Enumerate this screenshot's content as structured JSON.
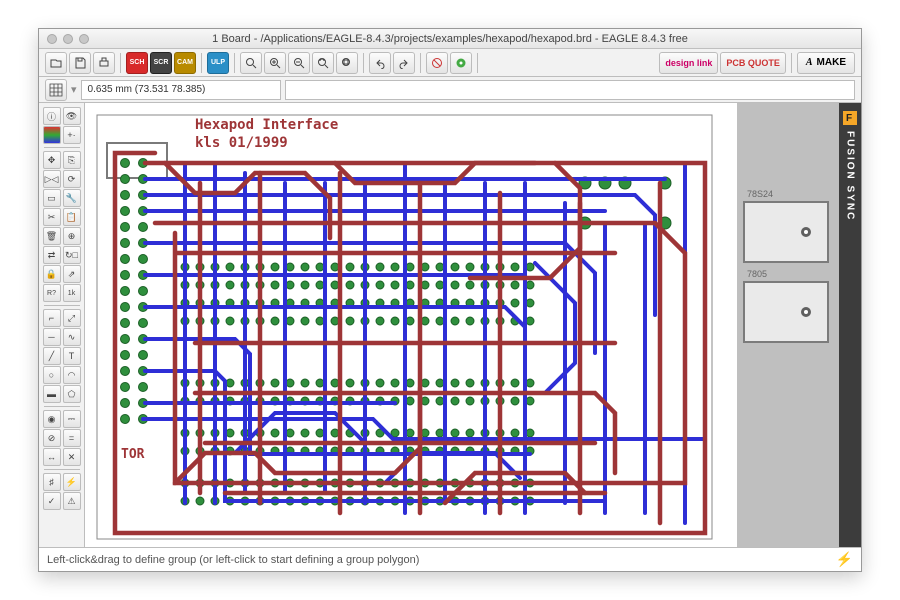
{
  "window": {
    "title": "1 Board - /Applications/EAGLE-8.4.3/projects/examples/hexapod/hexapod.brd - EAGLE 8.4.3 free"
  },
  "toolbar": {
    "sch": "SCH",
    "scr": "SCR",
    "cam": "CAM",
    "ulp": "ULP",
    "design_link": "design link",
    "pcb_quote": "PCB QUOTE",
    "make": "MAKE",
    "autodesk_glyph": "A"
  },
  "coord_readout": "0.635 mm (73.531 78.385)",
  "silkscreen": {
    "line1": "Hexapod Interface",
    "line2": "kls 01/1999",
    "tor": "TOR"
  },
  "components": {
    "reg1": "78S24",
    "reg2": "7805"
  },
  "right_strip": "FUSION SYNC",
  "statusbar": {
    "hint": "Left-click&drag to define group (or left-click to start defining a group polygon)"
  },
  "colors": {
    "top_trace": "#9e3537",
    "bottom_trace": "#2e2ed6",
    "pad": "#2f8f3d"
  }
}
